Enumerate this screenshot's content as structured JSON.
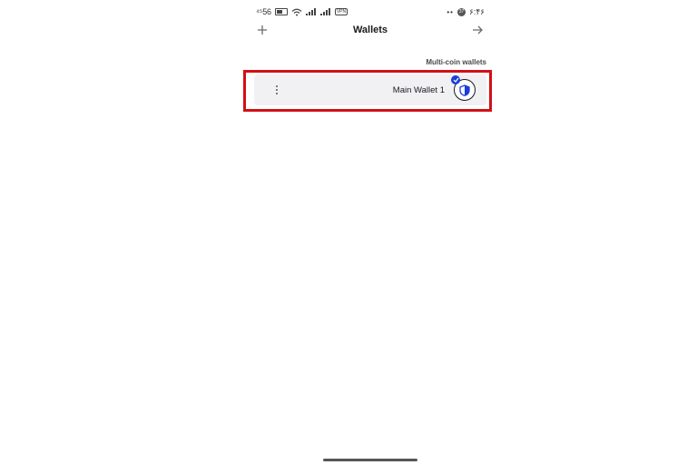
{
  "status_bar": {
    "network": "⁴⁵56",
    "vpn": "VPN",
    "clock_badge": "37",
    "time": "۶:۴۶"
  },
  "app_bar": {
    "title": "Wallets"
  },
  "section": {
    "label": "Multi-coin wallets"
  },
  "wallets": [
    {
      "name": "Main Wallet 1",
      "selected": true
    }
  ],
  "colors": {
    "highlight": "#d30f16",
    "accent": "#1a3ed6",
    "row_background": "#f1f1f4"
  },
  "icons": {
    "add": "plus-icon",
    "forward": "arrow-right-icon",
    "menu": "kebab-menu-icon",
    "wallet": "shield-icon",
    "selected": "check-icon"
  }
}
